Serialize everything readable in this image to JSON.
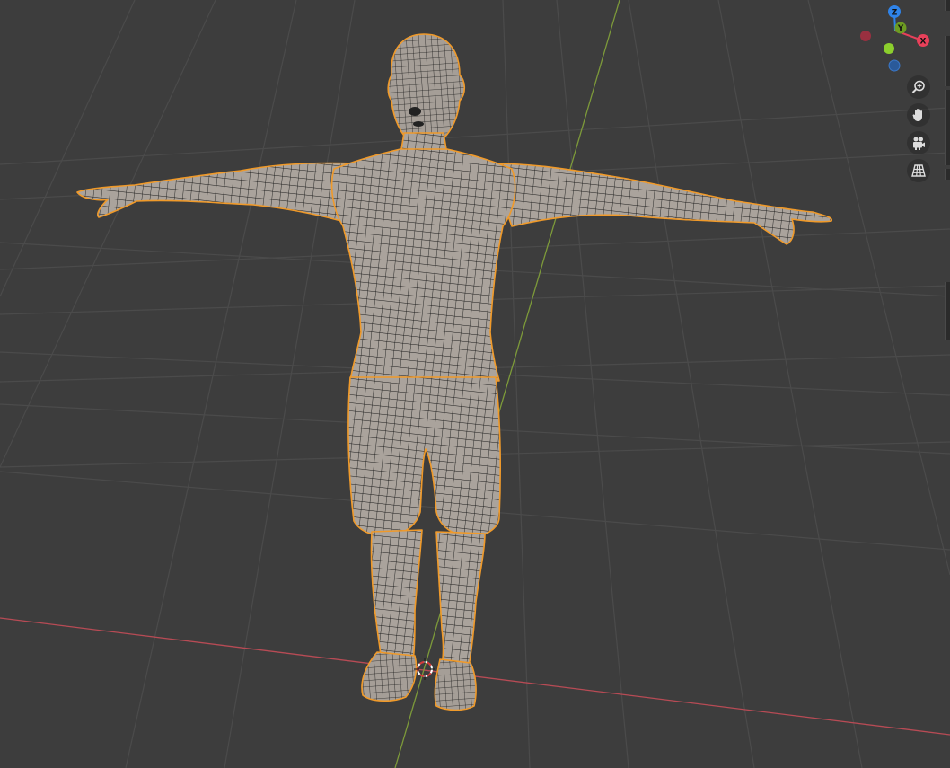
{
  "viewport": {
    "background_color": "#3d3d3d",
    "grid_color": "#4b4b4b",
    "x_axis_color": "#b84b55",
    "y_axis_color": "#7d9a3a"
  },
  "mesh": {
    "fill_color": "#aaa39c",
    "wire_color": "#1b1b1b",
    "selection_outline_color": "#f09a2a"
  },
  "gizmo": {
    "z_label": "Z",
    "y_label": "Y",
    "x_label": "X",
    "x_color": "#e8405a",
    "y_color": "#8ccf2d",
    "z_color": "#2f83e8",
    "neg_x_color": "#9a3040",
    "neg_z_color": "#2a5a9a"
  },
  "navigation_buttons": [
    {
      "icon": "zoom-in-icon"
    },
    {
      "icon": "hand-pan-icon"
    },
    {
      "icon": "camera-icon"
    },
    {
      "icon": "perspective-grid-icon"
    }
  ]
}
